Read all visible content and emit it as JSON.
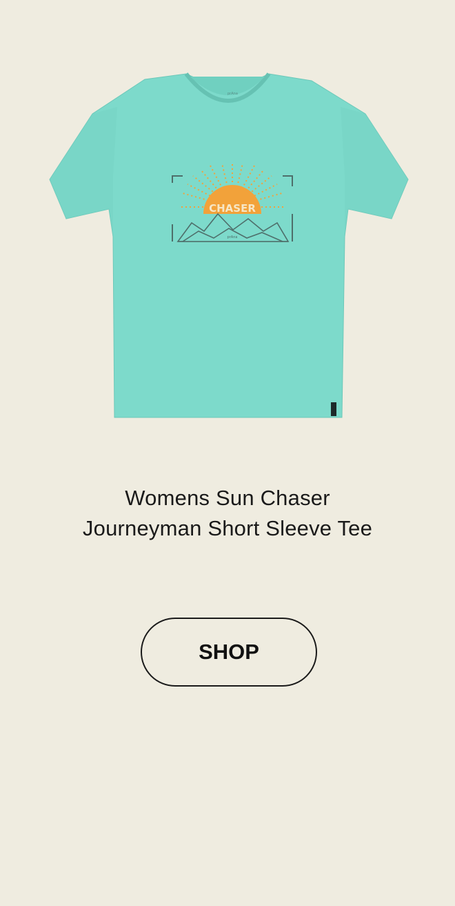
{
  "product": {
    "title_line1": "Womens Sun Chaser",
    "title_line2": "Journeyman Short Sleeve Tee",
    "graphic_text": "CHASER",
    "image_icon": "t-shirt-icon",
    "colors": {
      "shirt": "#7DDACB",
      "sun": "#F2A23A",
      "ink": "#4E6E6A"
    }
  },
  "cta": {
    "label": "SHOP"
  },
  "colors": {
    "background": "#EFECE0",
    "text": "#1a1a1a"
  }
}
